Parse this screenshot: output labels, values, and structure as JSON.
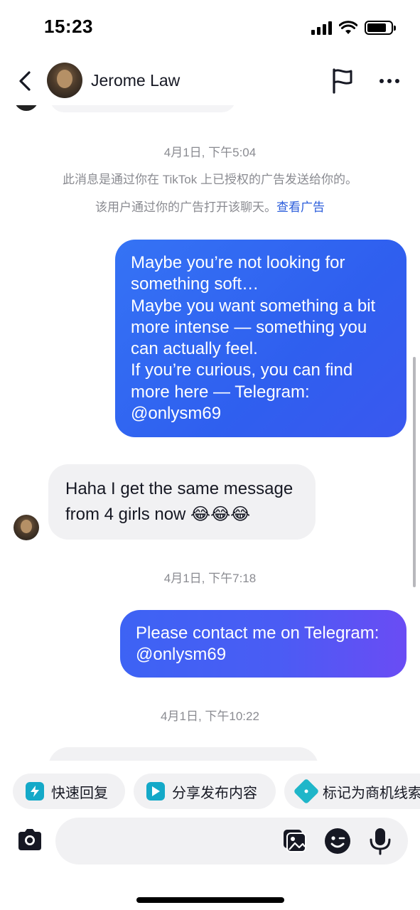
{
  "status_bar": {
    "time": "15:23"
  },
  "nav": {
    "contact_name": "Jerome Law",
    "icons": {
      "back": "chevron-left-icon",
      "report": "flag-icon",
      "more": "more-horizontal-icon"
    }
  },
  "chat": {
    "timestamps": [
      "4月1日, 下午5:04",
      "4月1日, 下午7:18",
      "4月1日, 下午10:22"
    ],
    "system_notice_1": "此消息是通过你在 TikTok 上已授权的广告发送给你的。",
    "system_notice_2": "该用户通过你的广告打开该聊天。",
    "system_link": "查看广告",
    "messages": [
      {
        "direction": "outgoing",
        "lines": [
          "Maybe you’re not looking for",
          "something soft…",
          "Maybe you want something a bit",
          "more intense — something you",
          "can actually feel.",
          "If you’re curious, you can find",
          "more here — Telegram:",
          "@onlysm69"
        ]
      },
      {
        "direction": "incoming",
        "lines": [
          "Haha I get the same message",
          "from 4 girls now 😂😂😂"
        ]
      },
      {
        "direction": "outgoing",
        "lines": [
          "Please contact me on Telegram:",
          "@onlysm69"
        ]
      }
    ]
  },
  "quick_actions": [
    {
      "label": "快速回复",
      "icon": "lightning-icon"
    },
    {
      "label": "分享发布内容",
      "icon": "play-icon"
    },
    {
      "label": "标记为商机线索",
      "icon": "tag-icon"
    }
  ],
  "composer": {
    "icons": {
      "camera": "camera-icon",
      "gallery": "image-icon",
      "emoji": "emoji-icon",
      "mic": "microphone-icon"
    }
  },
  "colors": {
    "outgoing_bubble": "#3573f5",
    "outgoing_bubble_end": "#6a4cf4",
    "incoming_bubble": "#f1f1f3",
    "link": "#2b5ddb",
    "chip_icon": "#14a9c8"
  }
}
